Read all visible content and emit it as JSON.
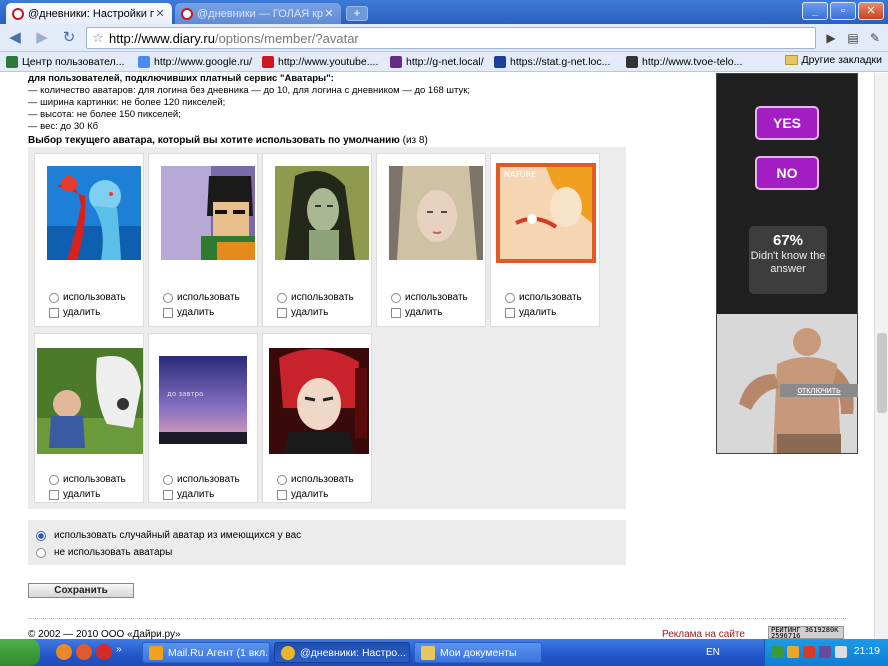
{
  "browser": {
    "tabs": [
      {
        "title": "@дневники: Настройки п...",
        "active": true
      },
      {
        "title": "@дневники — ГОЛАЯ кри...",
        "active": false
      }
    ],
    "url_host": "http://www.diary.ru",
    "url_path": "/options/member/?avatar",
    "bookmarks": [
      {
        "label": "Центр пользовател...",
        "icon": "kaspersky-icon",
        "color": "#2f7a3a"
      },
      {
        "label": "http://www.google.ru/",
        "icon": "google-icon",
        "color": "#4a8af4"
      },
      {
        "label": "http://www.youtube....",
        "icon": "youtube-icon",
        "color": "#cc181e"
      },
      {
        "label": "http://g-net.local/",
        "icon": "gnet-icon",
        "color": "#6a2a8a"
      },
      {
        "label": "https://stat.g-net.loc...",
        "icon": "stat-icon",
        "color": "#1b3f9a"
      },
      {
        "label": "http://www.tvoe-telo...",
        "icon": "tvoe-icon",
        "color": "#333333"
      }
    ],
    "other_bookmarks": "Другие закладки"
  },
  "requirements": {
    "heading": "для пользователей, подключивших платный сервис \"Аватары\":",
    "lines": [
      "— количество аватаров: для логина без дневника — до 10, для логина с дневником — до 168 штук;",
      "— ширина картинки: не более 120 пикселей;",
      "— высота: не более 150 пикселей;",
      "— вес: до 30 Кб"
    ]
  },
  "select": {
    "title": "Выбор текущего аватара, который вы хотите использовать по умолчанию",
    "count_note": "(из 8)",
    "use_label": "использовать",
    "delete_label": "удалить"
  },
  "avatars": [
    {
      "id": "blue-girl-red-flower"
    },
    {
      "id": "anime-boy-orange"
    },
    {
      "id": "green-woman"
    },
    {
      "id": "elf-portrait"
    },
    {
      "id": "nature-girl-bird",
      "caption": "NATURE"
    },
    {
      "id": "child-white-horse"
    },
    {
      "id": "purple-sky",
      "caption": "до завтра"
    },
    {
      "id": "red-hair-anime"
    }
  ],
  "global_options": [
    {
      "label": "использовать случайный аватар из имеющихся у вас",
      "checked": true
    },
    {
      "label": "не использовать аватары",
      "checked": false
    }
  ],
  "save_label": "Сохранить",
  "footer": {
    "copyright": "© 2002 — 2010 ООО «Дайри.ру»",
    "ad_link": "Реклама на сайте",
    "counter_lines": [
      "РЕЙТИНГ 3619280K",
      "2596716"
    ]
  },
  "ad": {
    "yes": "YES",
    "no": "NO",
    "percent": "67%",
    "stat_text": "Didn't know the answer",
    "disable": "отключить"
  },
  "taskbar": {
    "tasks": [
      {
        "label": "Mail.Ru Агент (1 вкл...",
        "icon": "mailru-agent-icon",
        "active": false
      },
      {
        "label": "@дневники: Настро...",
        "icon": "chrome-icon",
        "active": true
      },
      {
        "label": "Мои документы",
        "icon": "folder-icon",
        "active": false
      }
    ],
    "lang": "EN",
    "clock": "21:19"
  }
}
